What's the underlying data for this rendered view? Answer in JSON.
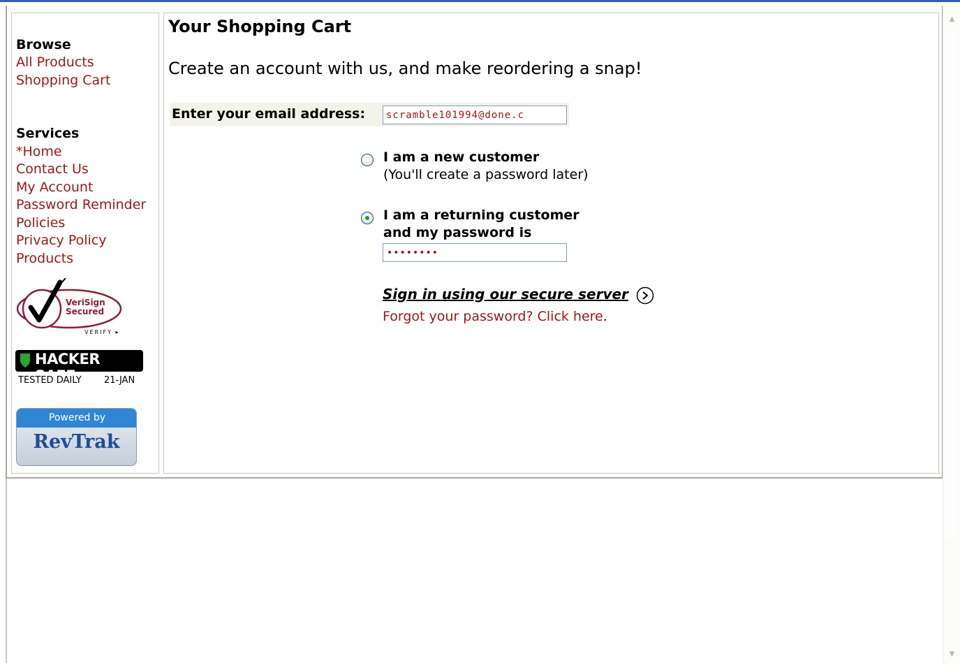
{
  "sidebar": {
    "browse_heading": "Browse",
    "browse_links": [
      "All Products",
      "Shopping Cart"
    ],
    "services_heading": "Services",
    "services_links": [
      "*Home",
      "Contact Us",
      "My Account",
      "Password Reminder",
      "Policies",
      "Privacy Policy",
      "Products"
    ],
    "badges": {
      "verisign_line1": "VeriSign",
      "verisign_line2": "Secured",
      "verisign_verify": "VERIFY",
      "hacker_safe": "HACKER SAFE",
      "hacker_tested": "TESTED DAILY",
      "hacker_date": "21-JAN",
      "powered_by": "Powered by",
      "revtrak": "RevTrak"
    }
  },
  "main": {
    "title": "Your Shopping Cart",
    "promo": "Create an account with us, and make reordering a snap!",
    "email_label": "Enter your email address:",
    "email_value": "scramble101994@done.c",
    "new_customer_label": "I am a new customer",
    "new_customer_sub": "(You'll create a password later)",
    "returning_label_line1": "I am a returning customer",
    "returning_label_line2": "and my password is",
    "password_value": "••••••••",
    "signin_link": "Sign in using our secure server",
    "forgot_link": "Forgot your password? Click here",
    "forgot_suffix": ".",
    "selected_option": "returning"
  },
  "colors": {
    "link": "#a01818",
    "top_bar": "#2f5fb5",
    "radio_checked": "#21a121"
  }
}
